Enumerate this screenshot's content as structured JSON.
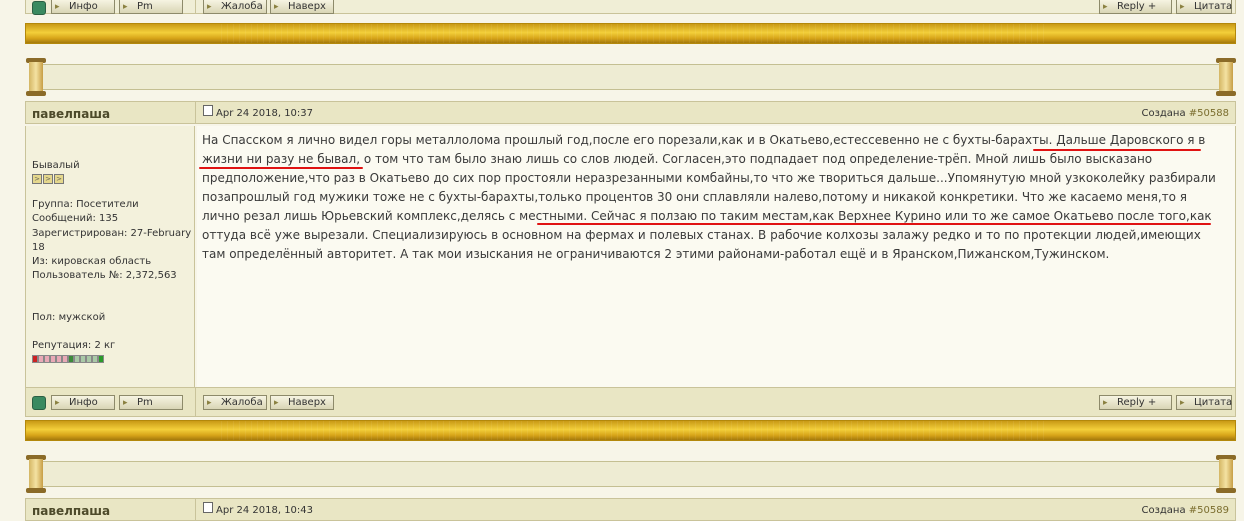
{
  "buttons": {
    "info": "Инфо",
    "pm": "Pm",
    "complaint": "Жалоба",
    "up": "Наверх",
    "reply": "Reply +",
    "quote": "Цитата"
  },
  "posts": [
    {
      "author": "павелпаша",
      "date": "Apr 24 2018, 10:37",
      "created_label": "Создана",
      "post_num": "#50588",
      "rank": "Бывалый",
      "group": "Группа: Посетители",
      "messages": "Сообщений: 135",
      "registered": "Зарегистрирован: 27-February 18",
      "from": "Из: кировская область",
      "user_num": "Пользователь №: 2,372,563",
      "gender": "Пол: мужской",
      "reputation": "Репутация: 2 кг",
      "body": "На Спасском я лично видел горы металлолома прошлый год,после его порезали,как и в Окатьево,естессевенно не с бухты-барахты. Дальше Даровского я в жизни ни разу не бывал, о том что там было знаю лишь со слов людей. Согласен,это подпадает под определение-трёп. Мной лишь было высказано предположение,что раз в Окатьево до сих пор простояли неразрезанными комбайны,то что же твориться дальше...Упомянутую мной узкоколейку разбирали позапрошлый год мужики тоже не с бухты-барахты,только процентов 30 они сплавляли налево,потому и никакой конкретики. Что же касаемо меня,то я лично резал лишь Юрьевский комплекс,делясь с местными. Сейчас я ползаю по таким местам,как Верхнее Курино или то же самое Окатьево после того,как оттуда всё уже вырезали. Специализируюсь в основном на фермах и полевых станах. В рабочие колхозы залажу редко и то по протекции людей,имеющих там определённый авторитет. А так мои изыскания не ограничиваются 2 этими районами-работал ещё и в Яранском,Пижанском,Тужинском."
    },
    {
      "author": "павелпаша",
      "date": "Apr 24 2018, 10:43",
      "created_label": "Создана",
      "post_num": "#50589"
    }
  ],
  "colors": {
    "underline": "#e01212",
    "gold_bar": "#e8b825",
    "username": "#4d4a2a"
  }
}
